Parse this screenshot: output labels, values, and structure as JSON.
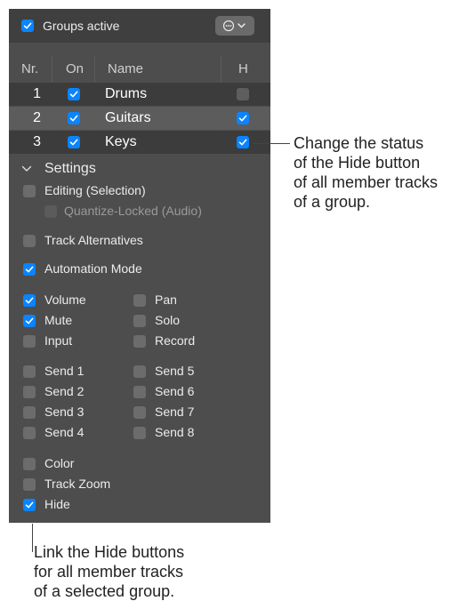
{
  "groups_active": {
    "label": "Groups active",
    "checked": true
  },
  "menu_icon": "ellipsis-circle-icon",
  "table": {
    "headers": {
      "nr": "Nr.",
      "on": "On",
      "name": "Name",
      "hide": "H"
    },
    "rows": [
      {
        "nr": "1",
        "on": true,
        "name": "Drums",
        "hide": false
      },
      {
        "nr": "2",
        "on": true,
        "name": "Guitars",
        "hide": true
      },
      {
        "nr": "3",
        "on": true,
        "name": "Keys",
        "hide": true
      }
    ]
  },
  "settings": {
    "title": "Settings",
    "editing": {
      "label": "Editing (Selection)",
      "checked": false
    },
    "quantize": {
      "label": "Quantize-Locked (Audio)",
      "checked": false
    },
    "track_alternatives": {
      "label": "Track Alternatives",
      "checked": false
    },
    "automation_mode": {
      "label": "Automation Mode",
      "checked": true
    },
    "volume": {
      "label": "Volume",
      "checked": true
    },
    "pan": {
      "label": "Pan",
      "checked": false
    },
    "mute": {
      "label": "Mute",
      "checked": true
    },
    "solo": {
      "label": "Solo",
      "checked": false
    },
    "input": {
      "label": "Input",
      "checked": false
    },
    "record": {
      "label": "Record",
      "checked": false
    },
    "send1": {
      "label": "Send 1",
      "checked": false
    },
    "send5": {
      "label": "Send 5",
      "checked": false
    },
    "send2": {
      "label": "Send 2",
      "checked": false
    },
    "send6": {
      "label": "Send 6",
      "checked": false
    },
    "send3": {
      "label": "Send 3",
      "checked": false
    },
    "send7": {
      "label": "Send 7",
      "checked": false
    },
    "send4": {
      "label": "Send 4",
      "checked": false
    },
    "send8": {
      "label": "Send 8",
      "checked": false
    },
    "color": {
      "label": "Color",
      "checked": false
    },
    "track_zoom": {
      "label": "Track Zoom",
      "checked": false
    },
    "hide": {
      "label": "Hide",
      "checked": true
    }
  },
  "callouts": {
    "right": [
      "Change the status",
      "of the Hide button",
      "of all member tracks",
      "of a group."
    ],
    "bottom": [
      "Link the Hide buttons",
      "for all member tracks",
      "of a selected group."
    ]
  }
}
